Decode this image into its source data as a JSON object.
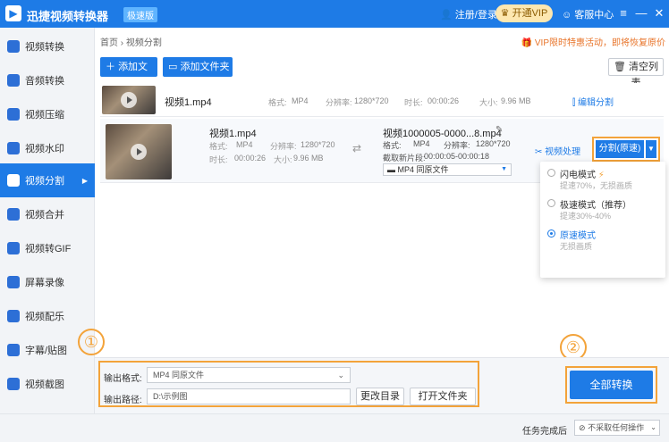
{
  "titlebar": {
    "app_title": "迅捷视频转换器",
    "edition": "极速版",
    "login": "注册/登录",
    "vip": "开通VIP",
    "service": "客服中心",
    "menu_icon": "≡",
    "min_icon": "—",
    "close_icon": "✕"
  },
  "sidebar": {
    "items": [
      {
        "label": "视频转换"
      },
      {
        "label": "音频转换"
      },
      {
        "label": "视频压缩"
      },
      {
        "label": "视频水印"
      },
      {
        "label": "视频分割"
      },
      {
        "label": "视频合并"
      },
      {
        "label": "视频转GIF"
      },
      {
        "label": "屏幕录像"
      },
      {
        "label": "视频配乐"
      },
      {
        "label": "字幕/贴图"
      },
      {
        "label": "视频截图"
      }
    ],
    "active_index": 4
  },
  "main": {
    "breadcrumb_home": "首页",
    "breadcrumb_sep": "›",
    "breadcrumb_current": "视频分割",
    "promo": "VIP限时特惠活动，即将恢复原价",
    "add_file": "添加文件",
    "add_folder": "添加文件夹",
    "clear_list": "清空列表"
  },
  "file1": {
    "name": "视频1.mp4",
    "format_label": "格式:",
    "format_value": "MP4",
    "res_label": "分辨率:",
    "res_value": "1280*720",
    "duration_label": "时长:",
    "duration_value": "00:00:26",
    "size_label": "大小:",
    "size_value": "9.96 MB",
    "edit_split": "编辑分割"
  },
  "file2": {
    "name": "视频1.mp4",
    "format_label": "格式:",
    "format_value": "MP4",
    "res_label": "分辨率:",
    "res_value": "1280*720",
    "duration_label": "时长:",
    "duration_value": "00:00:26",
    "size_label": "大小:",
    "size_value": "9.96 MB",
    "output_name": "视频1000005-0000...8.mp4",
    "out_format_label": "格式:",
    "out_format_value": "MP4",
    "out_res_label": "分辨率:",
    "out_res_value": "1280*720",
    "clip_label": "截取新片段:",
    "clip_value": "00:00:05-00:00:18",
    "format_select": "MP4  同原文件",
    "video_process": "视频处理",
    "split_btn": "分割(原速)"
  },
  "split_menu": {
    "options": [
      {
        "title": "闪电模式",
        "sub": "提速70%，无损画质"
      },
      {
        "title": "极速模式（推荐）",
        "sub": "提速30%-40%"
      },
      {
        "title": "原速模式",
        "sub": "无损画质"
      }
    ],
    "selected_index": 2
  },
  "bottom": {
    "output_format_label": "输出格式:",
    "output_format_value": "MP4  同原文件",
    "output_path_label": "输出路径:",
    "output_path_value": "D:\\示例图",
    "change_dir": "更改目录",
    "open_folder": "打开文件夹",
    "convert_all": "全部转换"
  },
  "statusbar": {
    "on_complete_label": "任务完成后",
    "on_complete_value": "不采取任何操作"
  },
  "markers": {
    "one": "①",
    "two": "②"
  },
  "colors": {
    "primary": "#1e7be6",
    "highlight": "#f3a33a",
    "promo": "#e8742a"
  }
}
